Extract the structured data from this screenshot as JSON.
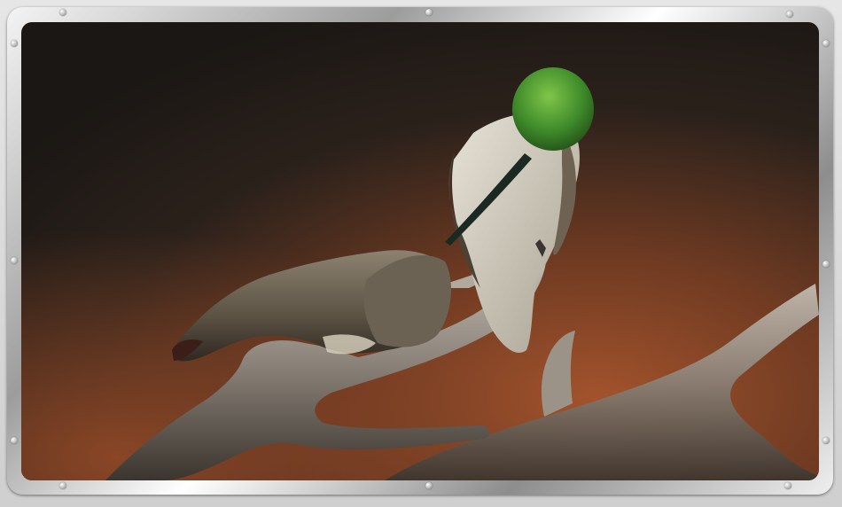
{
  "scene": {
    "subject": "hummingbird",
    "icons": [
      "screw-icon"
    ],
    "colors": {
      "background_dark": "#201a16",
      "background_warm": "#a2532c",
      "frame_metal": "#b9b9b9",
      "adult_head_green": "#4f9a2f",
      "chick_feathers": "#6c6253",
      "branch": "#8f877c"
    }
  }
}
